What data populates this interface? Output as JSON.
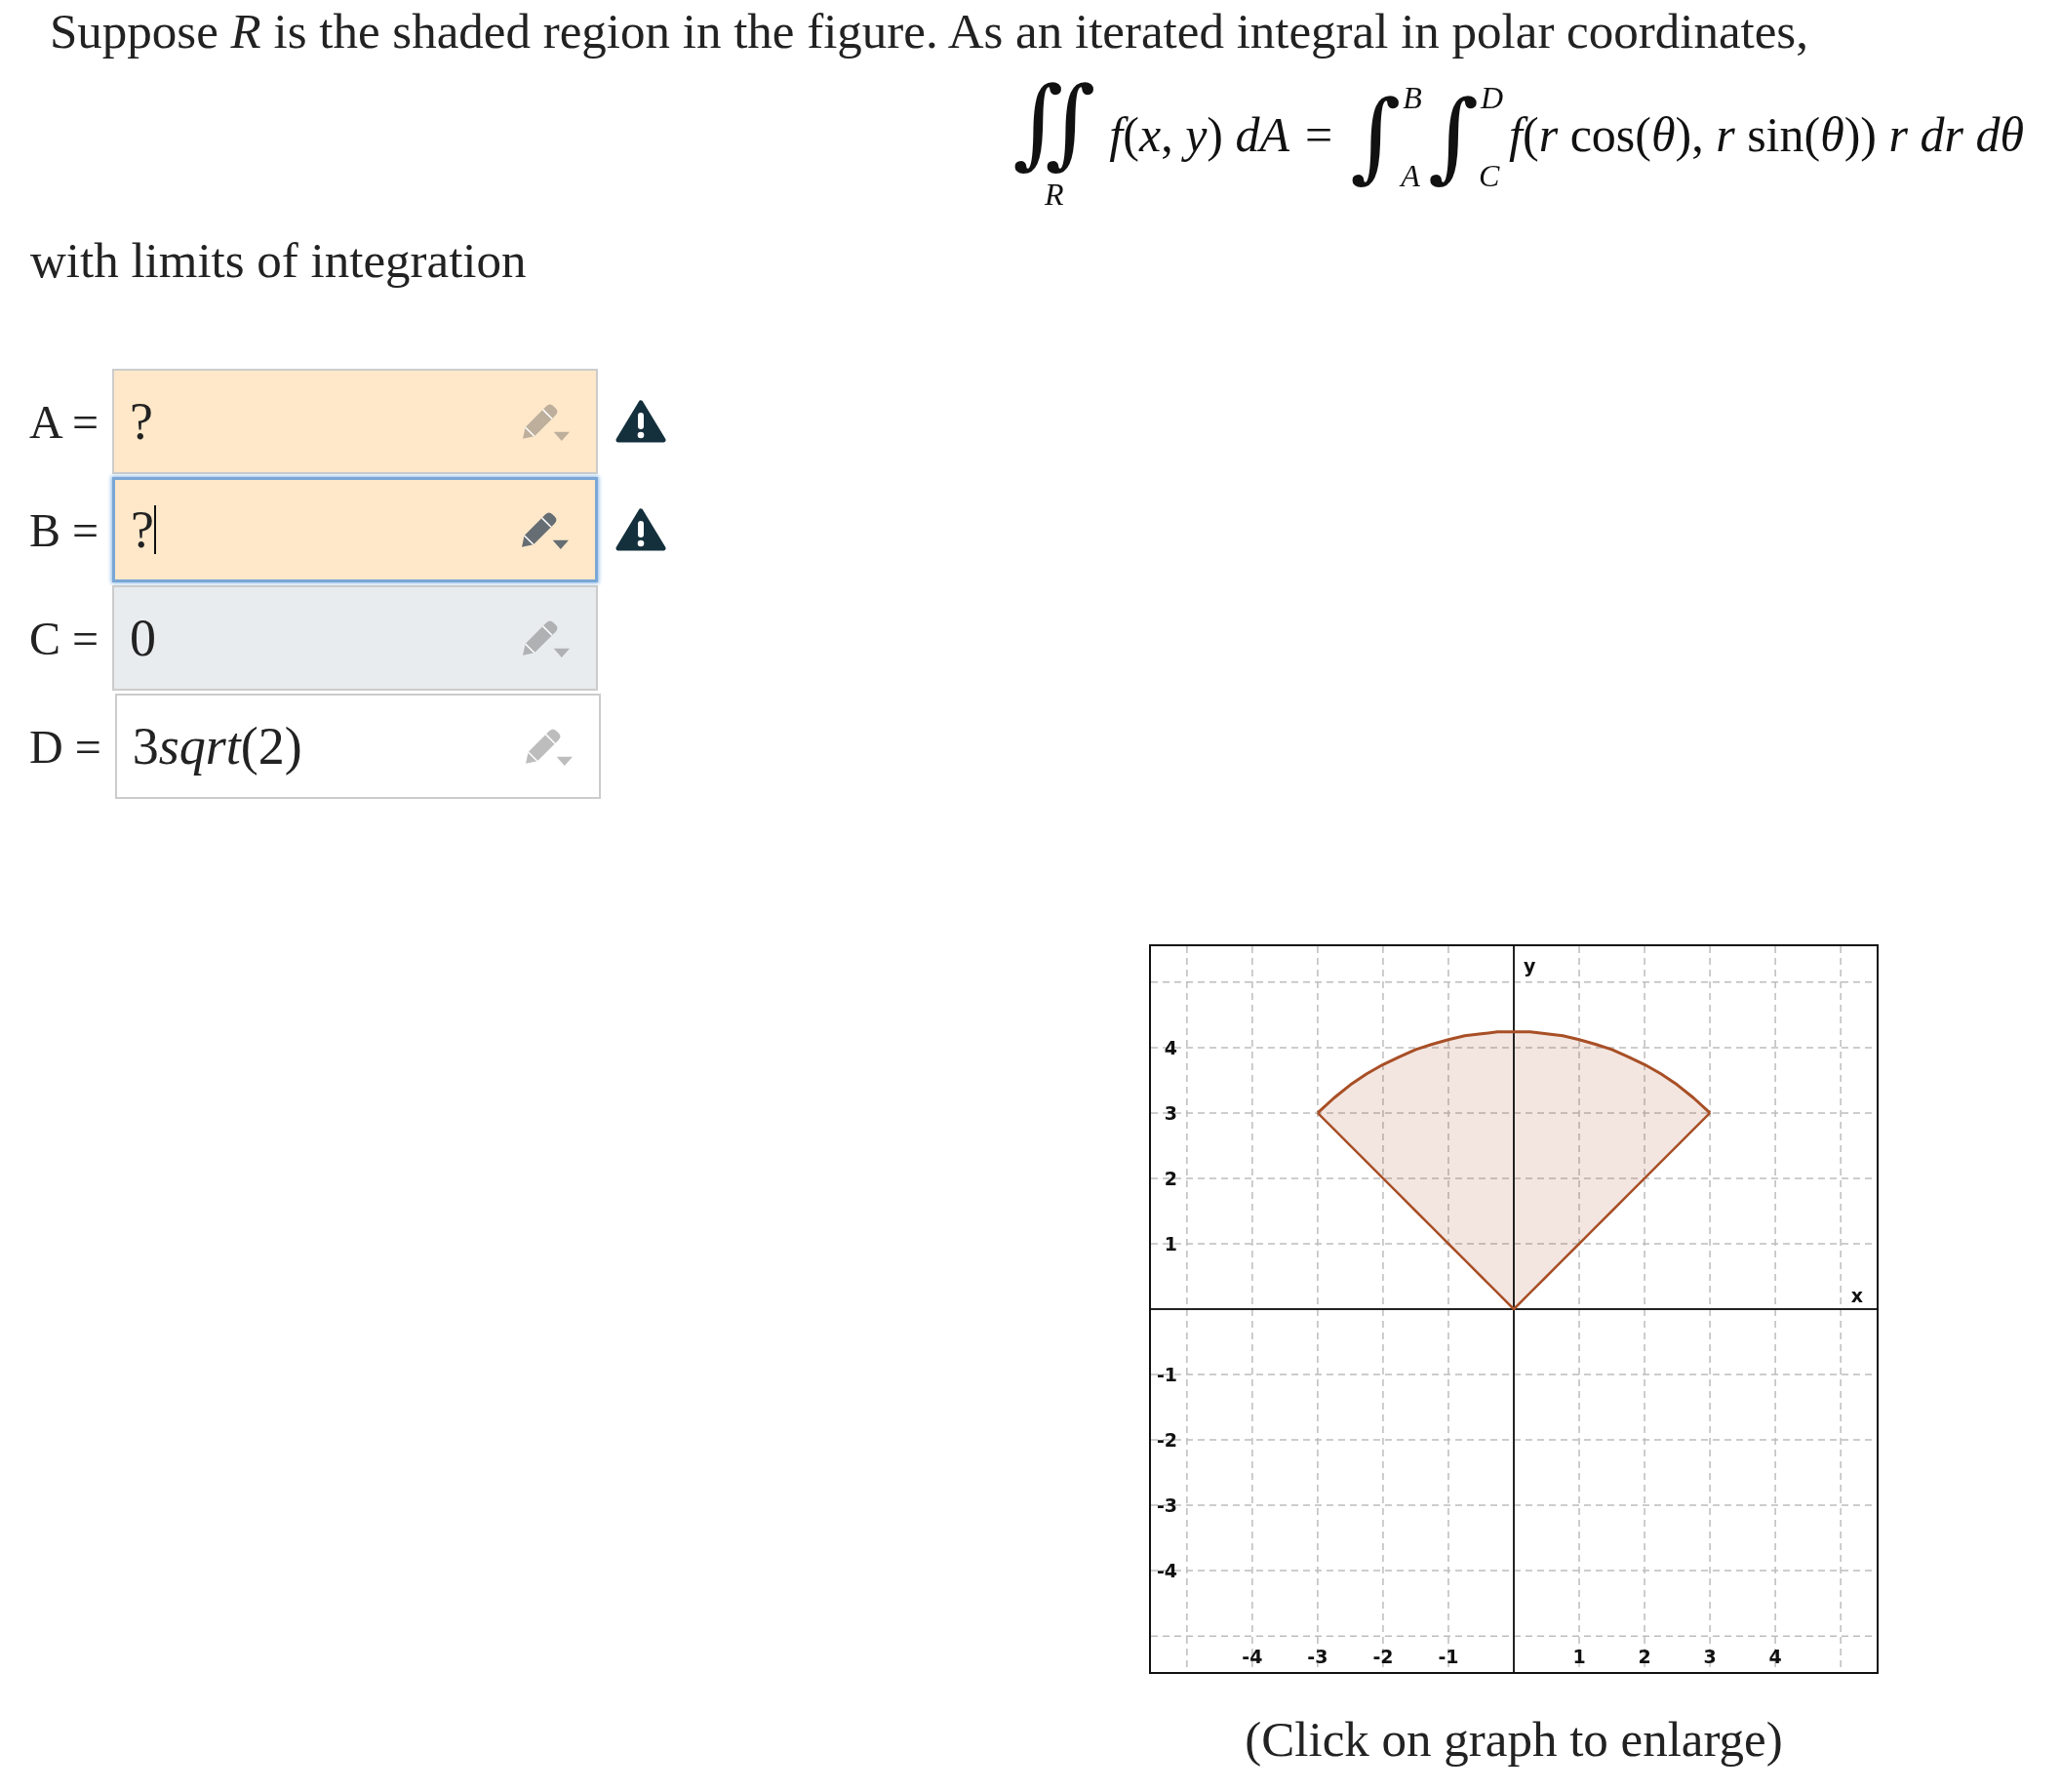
{
  "question": {
    "intro": "Suppose *R* is the shaded region in the figure. As an iterated integral in polar coordinates,",
    "formula": {
      "lhs_integral": "∬",
      "lhs_region": "R",
      "lhs_integrand": "*f*(*x*, *y*) *dA*",
      "equals": "=",
      "outer_integral": "∫",
      "outer_upper": "B",
      "outer_lower": "A",
      "inner_integral": "∫",
      "inner_upper": "D",
      "inner_lower": "C",
      "integrand": "*f*(*r* cos(*θ*), *r* sin(*θ*)) *r dr dθ*"
    },
    "prompt": "with limits of integration"
  },
  "fields": [
    {
      "label": "A =",
      "value": "?",
      "invalid": true,
      "focused": false,
      "hovered": false
    },
    {
      "label": "B =",
      "value": "?",
      "invalid": true,
      "focused": true,
      "hovered": false
    },
    {
      "label": "C =",
      "value": "0",
      "invalid": false,
      "focused": false,
      "hovered": true
    },
    {
      "label": "D =",
      "value": "3sqrt(2)",
      "invalid": false,
      "focused": false,
      "hovered": false
    }
  ],
  "figure": {
    "chart_data": {
      "type": "area",
      "xlabel": "x",
      "ylabel": "y",
      "grid": true,
      "x": [
        -3,
        -2.75,
        -2.5,
        -2.25,
        -2,
        -1.75,
        -1.5,
        -1.25,
        -1,
        -0.75,
        -0.5,
        -0.25,
        0,
        0.25,
        0.5,
        0.75,
        1,
        1.25,
        1.5,
        1.75,
        2,
        2.25,
        2.5,
        2.75,
        3
      ],
      "series": [
        {
          "color": "#a84f26",
          "values": [
            3,
            3.23,
            3.43,
            3.6,
            3.74,
            3.86,
            3.97,
            4.05,
            4.12,
            4.18,
            4.21,
            4.24,
            4.24,
            4.24,
            4.21,
            4.18,
            4.12,
            4.05,
            3.97,
            3.86,
            3.74,
            3.6,
            3.43,
            3.23,
            3
          ]
        },
        {
          "type": "line",
          "color": "#a84f26",
          "values": [
            3,
            2.75,
            2.5,
            2.25,
            2,
            1.75,
            1.5,
            1.25,
            1,
            0.75,
            0.5,
            0.25,
            0,
            0.25,
            0.5,
            0.75,
            1,
            1.25,
            1.5,
            1.75,
            2,
            2.25,
            2.5,
            2.75,
            3
          ]
        }
      ],
      "xlim": [
        -5.55,
        5.55
      ],
      "ylim": [
        -5.55,
        5.55
      ],
      "xticks": [
        -4,
        -3,
        -2,
        -1,
        1,
        2,
        3,
        4
      ],
      "yticks": [
        -4,
        -3,
        -2,
        -1,
        1,
        2,
        3,
        4
      ]
    },
    "caption": "(Click on graph to enlarge)"
  }
}
